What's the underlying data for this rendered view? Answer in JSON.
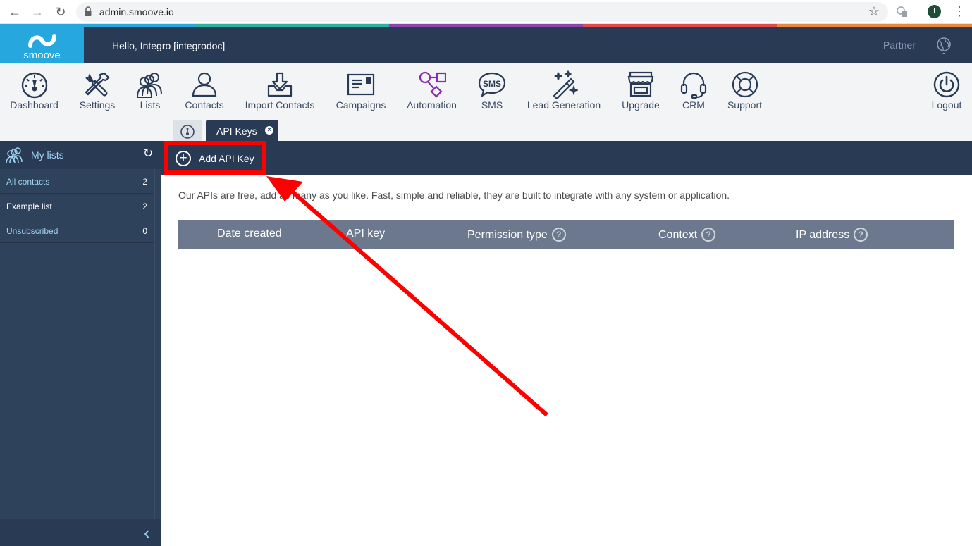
{
  "browser": {
    "url": "admin.smoove.io",
    "profile_initial": "I",
    "back_icon": "arrow-left-icon",
    "forward_icon": "arrow-right-icon",
    "reload_icon": "reload-icon"
  },
  "colors": {
    "strip": [
      "#26a7de",
      "#2bb3a0",
      "#8e44ad",
      "#e04b4b",
      "#e98a3a"
    ],
    "header": "#283a54",
    "logo_bg": "#26a7de",
    "accent_red": "#ff0000"
  },
  "header": {
    "logo_text": "smoove",
    "greeting": "Hello, Integro [integrodoc]",
    "partner": "Partner"
  },
  "toolbar": {
    "items": [
      {
        "label": "Dashboard",
        "icon": "gauge-icon"
      },
      {
        "label": "Settings",
        "icon": "tools-icon"
      },
      {
        "label": "Lists",
        "icon": "people-group-icon"
      },
      {
        "label": "Contacts",
        "icon": "person-icon"
      },
      {
        "label": "Import Contacts",
        "icon": "import-tray-icon"
      },
      {
        "label": "Campaigns",
        "icon": "envelope-icon"
      },
      {
        "label": "Automation",
        "icon": "flow-icon"
      },
      {
        "label": "SMS",
        "icon": "sms-bubble-icon"
      },
      {
        "label": "Lead Generation",
        "icon": "magic-wand-icon"
      },
      {
        "label": "Upgrade",
        "icon": "store-icon"
      },
      {
        "label": "CRM",
        "icon": "headset-icon"
      },
      {
        "label": "Support",
        "icon": "lifebuoy-icon"
      }
    ],
    "logout": "Logout"
  },
  "tabs": {
    "active_label": "API Keys"
  },
  "sidebar": {
    "title": "My lists",
    "items": [
      {
        "name": "All contacts",
        "count": "2",
        "color": "#9fd4f2"
      },
      {
        "name": "Example list",
        "count": "2",
        "color": "#ffffff"
      },
      {
        "name": "Unsubscribed",
        "count": "0",
        "color": "#9fd4f2"
      }
    ]
  },
  "main": {
    "add_button": "Add API Key",
    "description": "Our APIs are free, add as many as you like. Fast, simple and reliable, they are built to integrate with any system or application.",
    "columns": [
      {
        "label": "Date created",
        "help": false
      },
      {
        "label": "API key",
        "help": false
      },
      {
        "label": "Permission type",
        "help": true
      },
      {
        "label": "Context",
        "help": true
      },
      {
        "label": "IP address",
        "help": true
      }
    ],
    "help_glyph": "?"
  }
}
